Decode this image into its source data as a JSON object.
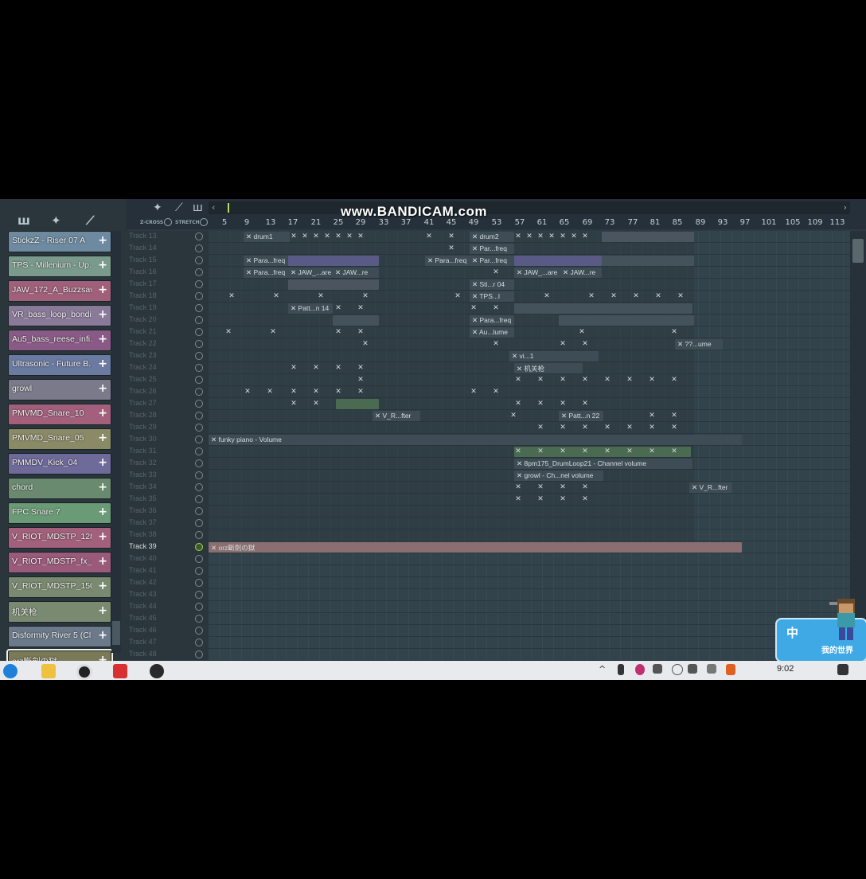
{
  "watermark": "www.BANDICAM.com",
  "browser": {
    "channels": [
      {
        "label": "StickzZ - Riser 07 A",
        "color": "#6d8aa0"
      },
      {
        "label": "TPS - Millenium - Up...",
        "color": "#7a9a8c"
      },
      {
        "label": "JAW_172_A_Buzzsaw2",
        "color": "#a1607a"
      },
      {
        "label": "VR_bass_loop_bondi...",
        "color": "#8a7a9a"
      },
      {
        "label": "Au5_bass_reese_infi...",
        "color": "#8a5a86"
      },
      {
        "label": "Ultrasonic - Future B...",
        "color": "#6a7aa0"
      },
      {
        "label": "growl",
        "color": "#7a7a8a"
      },
      {
        "label": "PMVMD_Snare_10",
        "color": "#a2607c"
      },
      {
        "label": "PMVMD_Snare_05",
        "color": "#8a8a66"
      },
      {
        "label": "PMMDV_Kick_04",
        "color": "#6e6a9a"
      },
      {
        "label": "chord",
        "color": "#6a8a70"
      },
      {
        "label": "FPC Snare 7",
        "color": "#6a9a76"
      },
      {
        "label": "V_RIOT_MDSTP_128_...",
        "color": "#a2607c"
      },
      {
        "label": "V_RIOT_MDSTP_fx_s...",
        "color": "#9a5a7a"
      },
      {
        "label": "V_RIOT_MDSTP_150_...",
        "color": "#7a8a70"
      },
      {
        "label": "机关枪",
        "color": "#7a8a70"
      },
      {
        "label": "Disformity River 5 (Cl...",
        "color": "#6a7a8a"
      },
      {
        "label": "orz斷劍の獄",
        "color": "#7a7a58"
      }
    ]
  },
  "header": {
    "zcross": "Z-CROSS",
    "stretch": "STRETCH"
  },
  "ruler": [
    "5",
    "9",
    "13",
    "17",
    "21",
    "25",
    "29",
    "33",
    "37",
    "41",
    "45",
    "49",
    "53",
    "57",
    "61",
    "65",
    "69",
    "73",
    "77",
    "81",
    "85",
    "89",
    "93",
    "97",
    "101",
    "105",
    "109",
    "113"
  ],
  "tracks": [
    "Track 13",
    "Track 14",
    "Track 15",
    "Track 16",
    "Track 17",
    "Track 18",
    "Track 19",
    "Track 20",
    "Track 21",
    "Track 22",
    "Track 23",
    "Track 24",
    "Track 25",
    "Track 26",
    "Track 27",
    "Track 28",
    "Track 29",
    "Track 30",
    "Track 31",
    "Track 32",
    "Track 33",
    "Track 34",
    "Track 35",
    "Track 36",
    "Track 37",
    "Track 38",
    "Track 39",
    "Track 40",
    "Track 41",
    "Track 42",
    "Track 43",
    "Track 44",
    "Track 45",
    "Track 46",
    "Track 47",
    "Track 48"
  ],
  "highlighted_track": "Track 39",
  "clips": {
    "drum1": "drum1",
    "drum2": "drum2",
    "para_freq": "Para...freq",
    "par_freq": "Par...freq",
    "jaw_are": "JAW_...are",
    "jaw_re": "JAW...re",
    "sti_04": "Sti...r 04",
    "tps": "TPS...l",
    "patt14": "Patt...n 14",
    "au_lume": "Au...lume",
    "ume": "??...ume",
    "funky": "funky piano - Volume",
    "vr_fter": "V_R...fter",
    "patt22": "Patt...n 22",
    "jiguanqiang": "机关枪",
    "bpm175": "8pm175_DrumLoop21 - Channel volume",
    "growl": "growl - Ch...nel volume",
    "vr_fter2": "V_R...fter",
    "orz": "orz斷劍の獄",
    "vi": "vi...1"
  },
  "ime": {
    "lang": "中",
    "text": "我的世界"
  },
  "taskbar": {
    "time": "9:02"
  }
}
